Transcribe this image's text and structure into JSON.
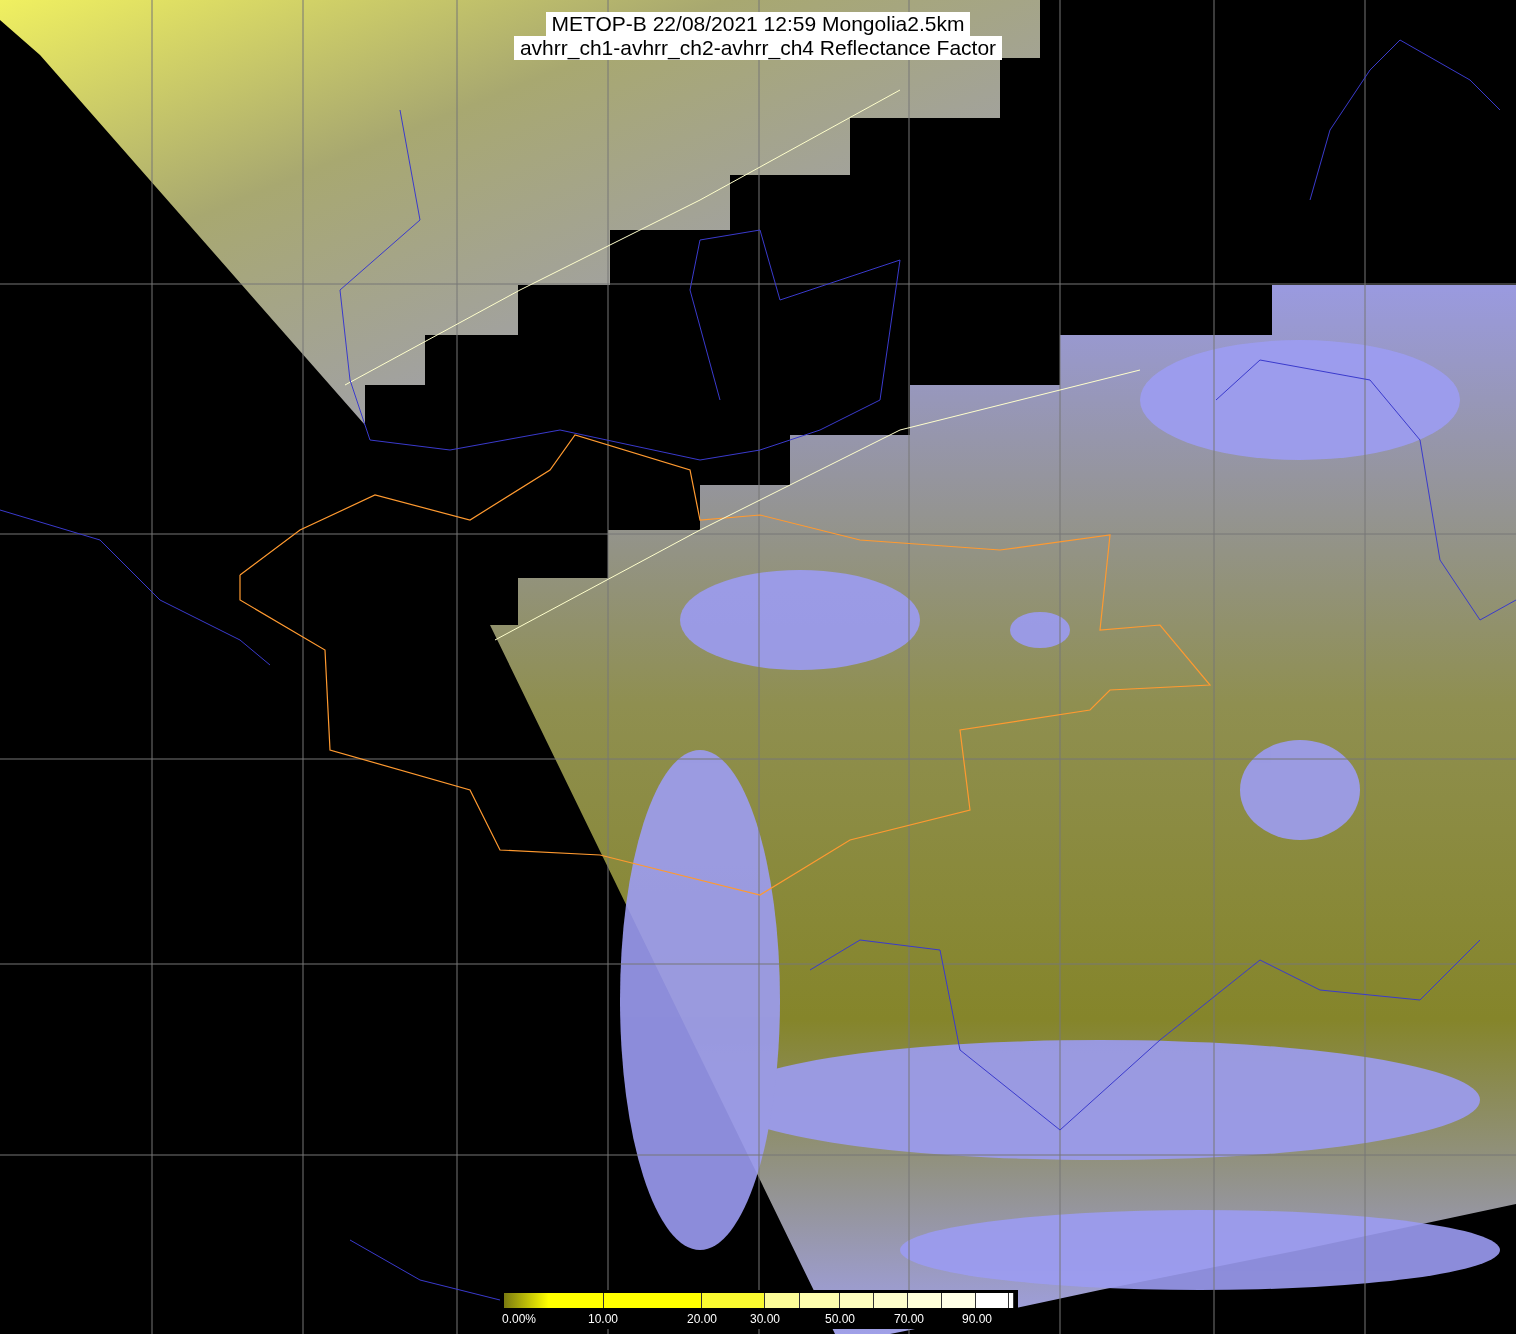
{
  "title_lines": [
    "METOP-B 22/08/2021 12:59 Mongolia2.5km",
    "avhrr_ch1-avhrr_ch2-avhrr_ch4 Reflectance Factor"
  ],
  "colorbar": {
    "segments": [
      {
        "color": "#ffff00",
        "label": "0.00%"
      },
      {
        "color": "#ffff00",
        "label": "10.00"
      },
      {
        "color": "#fafa30",
        "label": "20.00"
      },
      {
        "color": "#fcfc98",
        "label": "30.00"
      },
      {
        "color": "#fdfdae"
      },
      {
        "color": "#fefebe",
        "label": "50.00"
      },
      {
        "color": "#fefecb"
      },
      {
        "color": "#ffffd8",
        "label": "70.00"
      },
      {
        "color": "#ffffe6"
      },
      {
        "color": "#ffffff",
        "label": "90.00"
      },
      {
        "color": "#ffffff"
      }
    ]
  }
}
